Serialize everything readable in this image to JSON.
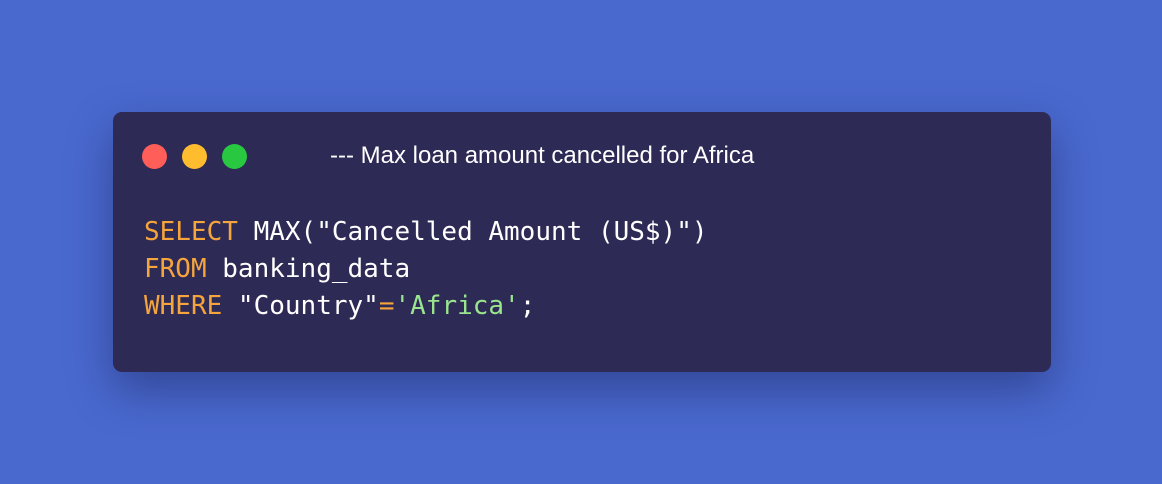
{
  "window": {
    "title": "--- Max loan amount cancelled for Africa",
    "controls": [
      {
        "name": "close",
        "color": "#ff5f58"
      },
      {
        "name": "minimize",
        "color": "#ffbc2e"
      },
      {
        "name": "zoom",
        "color": "#29c841"
      }
    ]
  },
  "colors": {
    "background": "#4a69cf",
    "window": "#2d2a55",
    "keyword": "#f6a43c",
    "string": "#9ae68e",
    "text": "#ffffff"
  },
  "code": {
    "line1": {
      "kw": "SELECT",
      "rest": " MAX(\"Cancelled Amount (US$)\")"
    },
    "line2": {
      "kw": "FROM",
      "rest": " banking_data"
    },
    "line3": {
      "kw": "WHERE",
      "ident": " \"Country\"",
      "op": "=",
      "str": "'Africa'",
      "end": ";"
    }
  }
}
